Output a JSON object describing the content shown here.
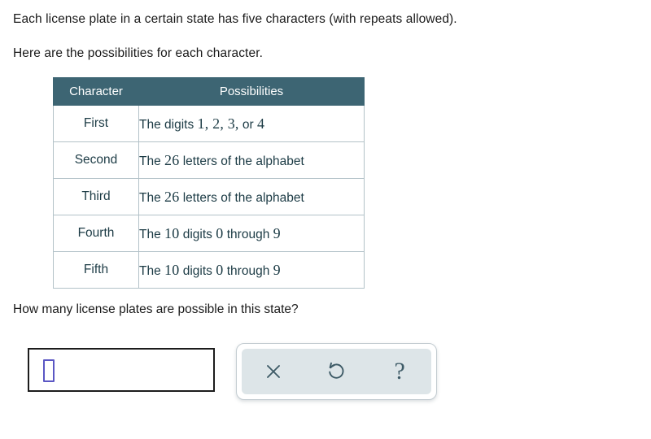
{
  "problem": {
    "intro_line_1": "Each license plate in a certain state has five characters (with repeats allowed).",
    "intro_line_2": "Here are the possibilities for each character.",
    "question": "How many license plates are possible in this state?"
  },
  "table": {
    "headers": [
      "Character",
      "Possibilities"
    ],
    "header_bg": "#3d6573",
    "header_text_color": "#ffffff",
    "border_color": "#b3c2c8",
    "body_text_color": "#1c3b45",
    "rows": [
      {
        "character": "First",
        "possibilities_prefix": "The digits ",
        "possibilities_numbers": "1, 2, 3,",
        "possibilities_mid": " or ",
        "possibilities_suffix_number": "4",
        "possibilities_suffix": "",
        "possibilities_full": "The digits 1, 2, 3, or 4"
      },
      {
        "character": "Second",
        "possibilities_prefix": "The ",
        "possibilities_numbers": "26",
        "possibilities_mid": "",
        "possibilities_suffix_number": "",
        "possibilities_suffix": " letters of the alphabet",
        "possibilities_full": "The 26 letters of the alphabet"
      },
      {
        "character": "Third",
        "possibilities_prefix": "The ",
        "possibilities_numbers": "26",
        "possibilities_mid": "",
        "possibilities_suffix_number": "",
        "possibilities_suffix": " letters of the alphabet",
        "possibilities_full": "The 26 letters of the alphabet"
      },
      {
        "character": "Fourth",
        "possibilities_prefix": "The ",
        "possibilities_numbers": "10",
        "possibilities_mid": " digits ",
        "possibilities_suffix_number": "0",
        "possibilities_suffix": " through ",
        "possibilities_trailing_number": "9",
        "possibilities_full": "The 10 digits 0 through 9"
      },
      {
        "character": "Fifth",
        "possibilities_prefix": "The ",
        "possibilities_numbers": "10",
        "possibilities_mid": " digits ",
        "possibilities_suffix_number": "0",
        "possibilities_suffix": " through ",
        "possibilities_trailing_number": "9",
        "possibilities_full": "The 10 digits 0 through 9"
      }
    ]
  },
  "answer": {
    "value": "",
    "placeholder": "",
    "caret_color": "#5b57c4",
    "border_color": "#1c1c1c"
  },
  "toolbar": {
    "panel_bg": "#dde5e8",
    "icon_color": "#3d5a66",
    "buttons": [
      {
        "name": "clear",
        "icon": "close-icon",
        "label": "×"
      },
      {
        "name": "undo",
        "icon": "undo-icon",
        "label": "↺"
      },
      {
        "name": "help",
        "icon": "question-mark-icon",
        "label": "?"
      }
    ]
  }
}
